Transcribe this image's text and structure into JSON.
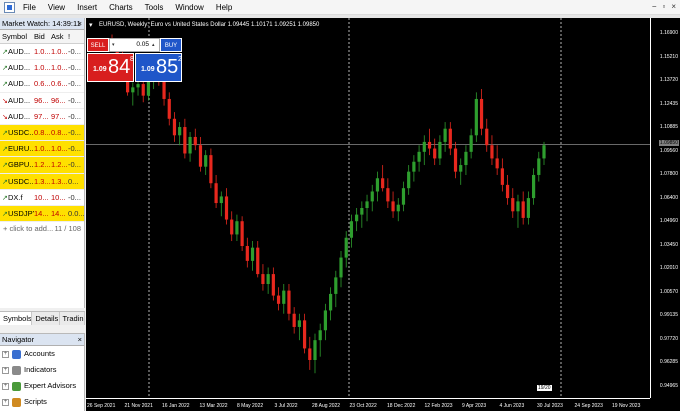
{
  "menu": {
    "items": [
      "File",
      "View",
      "Insert",
      "Charts",
      "Tools",
      "Window",
      "Help"
    ],
    "window_controls": [
      "−",
      "▫",
      "×"
    ]
  },
  "market_watch": {
    "title": "Market Watch: 14:39:11",
    "columns": [
      "Symbol",
      "Bid",
      "Ask",
      "!"
    ],
    "rows": [
      {
        "symbol": "AUD...",
        "bid": "1.0...",
        "ask": "1.0...",
        "spread": "-0...",
        "dir": "up",
        "highlight": false
      },
      {
        "symbol": "AUD...",
        "bid": "1.0...",
        "ask": "1.0...",
        "spread": "-0...",
        "dir": "up",
        "highlight": false
      },
      {
        "symbol": "AUD...",
        "bid": "0.6...",
        "ask": "0.6...",
        "spread": "-0...",
        "dir": "up",
        "highlight": false
      },
      {
        "symbol": "AUD...",
        "bid": "96...",
        "ask": "96...",
        "spread": "-0...",
        "dir": "down",
        "highlight": false
      },
      {
        "symbol": "AUD...",
        "bid": "97...",
        "ask": "97...",
        "spread": "-0...",
        "dir": "down",
        "highlight": false
      },
      {
        "symbol": "USDC...",
        "bid": "0.8...",
        "ask": "0.8...",
        "spread": "-0...",
        "dir": "up",
        "highlight": true
      },
      {
        "symbol": "EURU...",
        "bid": "1.0...",
        "ask": "1.0...",
        "spread": "-0...",
        "dir": "up",
        "highlight": true
      },
      {
        "symbol": "GBPU...",
        "bid": "1.2...",
        "ask": "1.2...",
        "spread": "-0...",
        "dir": "up",
        "highlight": true
      },
      {
        "symbol": "USDC...",
        "bid": "1.3...",
        "ask": "1.3...",
        "spread": "0...",
        "dir": "up",
        "highlight": true
      },
      {
        "symbol": "DX.f",
        "bid": "10...",
        "ask": "10...",
        "spread": "-0...",
        "dir": "up",
        "highlight": false
      },
      {
        "symbol": "USDJPY",
        "bid": "14...",
        "ask": "14...",
        "spread": "0.0...",
        "dir": "up",
        "highlight": true
      }
    ],
    "add_label": "+ click to add...",
    "count": "11 / 108",
    "tabs": [
      "Symbols",
      "Details",
      "Tradin"
    ]
  },
  "navigator": {
    "title": "Navigator",
    "items": [
      {
        "label": "Accounts",
        "color": "#3a6fd0"
      },
      {
        "label": "Indicators",
        "color": "#8a8a8a"
      },
      {
        "label": "Expert Advisors",
        "color": "#4a9a3a"
      },
      {
        "label": "Scripts",
        "color": "#d08a20"
      }
    ]
  },
  "chart": {
    "title": "EURUSD, Weekly: Euro vs United States Dollar  1.09445  1.10171  1.09251  1.09850",
    "price_labels": [
      "1.16900",
      "1.15210",
      "1.13720",
      "1.12435",
      "1.10885",
      "1.09560",
      "1.07800",
      "1.06400",
      "1.04960",
      "1.03450",
      "1.02010",
      "1.00570",
      "0.99135",
      "0.97720",
      "0.96285",
      "0.94965"
    ],
    "current_price": "1.09850",
    "time_labels": [
      "26 Sep 2021",
      "21 Nov 2021",
      "16 Jan 2022",
      "13 Mar 2022",
      "8 May 2022",
      "3 Jul 2022",
      "28 Aug 2022",
      "23 Oct 2022",
      "18 Dec 2022",
      "12 Feb 2023",
      "9 Apr 2023",
      "4 Jun 2023",
      "30 Jul 2023",
      "24 Sep 2023",
      "19 Nov 2023"
    ],
    "cursor_badge": "19/20",
    "up_color": "#2e9e2e",
    "down_color": "#e8281e",
    "candles": [
      [
        1.16,
        1.165,
        1.155,
        1.158
      ],
      [
        1.158,
        1.162,
        1.15,
        1.153
      ],
      [
        1.153,
        1.158,
        1.145,
        1.15
      ],
      [
        1.15,
        1.152,
        1.128,
        1.13
      ],
      [
        1.13,
        1.136,
        1.122,
        1.133
      ],
      [
        1.133,
        1.14,
        1.128,
        1.135
      ],
      [
        1.135,
        1.138,
        1.124,
        1.128
      ],
      [
        1.128,
        1.14,
        1.125,
        1.137
      ],
      [
        1.137,
        1.146,
        1.132,
        1.142
      ],
      [
        1.142,
        1.148,
        1.134,
        1.138
      ],
      [
        1.138,
        1.144,
        1.122,
        1.126
      ],
      [
        1.126,
        1.13,
        1.11,
        1.114
      ],
      [
        1.114,
        1.118,
        1.1,
        1.104
      ],
      [
        1.104,
        1.112,
        1.098,
        1.109
      ],
      [
        1.109,
        1.114,
        1.09,
        1.093
      ],
      [
        1.093,
        1.106,
        1.088,
        1.103
      ],
      [
        1.103,
        1.108,
        1.095,
        1.098
      ],
      [
        1.098,
        1.103,
        1.082,
        1.085
      ],
      [
        1.085,
        1.095,
        1.08,
        1.092
      ],
      [
        1.092,
        1.096,
        1.072,
        1.075
      ],
      [
        1.075,
        1.08,
        1.06,
        1.063
      ],
      [
        1.063,
        1.07,
        1.055,
        1.067
      ],
      [
        1.067,
        1.072,
        1.05,
        1.053
      ],
      [
        1.053,
        1.058,
        1.04,
        1.044
      ],
      [
        1.044,
        1.056,
        1.04,
        1.052
      ],
      [
        1.052,
        1.055,
        1.034,
        1.037
      ],
      [
        1.037,
        1.042,
        1.024,
        1.028
      ],
      [
        1.028,
        1.04,
        1.022,
        1.036
      ],
      [
        1.036,
        1.04,
        1.018,
        1.02
      ],
      [
        1.02,
        1.026,
        1.01,
        1.014
      ],
      [
        1.014,
        1.024,
        1.008,
        1.02
      ],
      [
        1.02,
        1.024,
        1.004,
        1.007
      ],
      [
        1.007,
        1.012,
        0.998,
        1.002
      ],
      [
        1.002,
        1.014,
        0.996,
        1.01
      ],
      [
        1.01,
        1.014,
        0.992,
        0.996
      ],
      [
        0.996,
        1.0,
        0.984,
        0.988
      ],
      [
        0.988,
        0.996,
        0.98,
        0.992
      ],
      [
        0.992,
        0.996,
        0.972,
        0.975
      ],
      [
        0.975,
        0.982,
        0.962,
        0.968
      ],
      [
        0.968,
        0.984,
        0.96,
        0.98
      ],
      [
        0.98,
        0.99,
        0.97,
        0.986
      ],
      [
        0.986,
        1.002,
        0.98,
        0.998
      ],
      [
        0.998,
        1.012,
        0.992,
        1.008
      ],
      [
        1.008,
        1.022,
        1.0,
        1.018
      ],
      [
        1.018,
        1.034,
        1.012,
        1.03
      ],
      [
        1.03,
        1.046,
        1.024,
        1.042
      ],
      [
        1.042,
        1.056,
        1.036,
        1.052
      ],
      [
        1.052,
        1.06,
        1.046,
        1.056
      ],
      [
        1.056,
        1.064,
        1.048,
        1.06
      ],
      [
        1.06,
        1.068,
        1.052,
        1.064
      ],
      [
        1.064,
        1.074,
        1.058,
        1.07
      ],
      [
        1.07,
        1.082,
        1.064,
        1.078
      ],
      [
        1.078,
        1.086,
        1.07,
        1.072
      ],
      [
        1.072,
        1.078,
        1.06,
        1.064
      ],
      [
        1.064,
        1.07,
        1.054,
        1.058
      ],
      [
        1.058,
        1.066,
        1.052,
        1.062
      ],
      [
        1.062,
        1.076,
        1.058,
        1.072
      ],
      [
        1.072,
        1.086,
        1.068,
        1.082
      ],
      [
        1.082,
        1.092,
        1.076,
        1.088
      ],
      [
        1.088,
        1.098,
        1.082,
        1.094
      ],
      [
        1.094,
        1.104,
        1.086,
        1.1
      ],
      [
        1.1,
        1.108,
        1.092,
        1.096
      ],
      [
        1.096,
        1.102,
        1.086,
        1.09
      ],
      [
        1.09,
        1.104,
        1.086,
        1.1
      ],
      [
        1.1,
        1.112,
        1.094,
        1.108
      ],
      [
        1.108,
        1.112,
        1.092,
        1.096
      ],
      [
        1.096,
        1.1,
        1.078,
        1.082
      ],
      [
        1.082,
        1.09,
        1.074,
        1.086
      ],
      [
        1.086,
        1.098,
        1.08,
        1.094
      ],
      [
        1.094,
        1.108,
        1.09,
        1.104
      ],
      [
        1.104,
        1.13,
        1.1,
        1.126
      ],
      [
        1.126,
        1.132,
        1.104,
        1.108
      ],
      [
        1.108,
        1.114,
        1.094,
        1.098
      ],
      [
        1.098,
        1.104,
        1.086,
        1.09
      ],
      [
        1.09,
        1.098,
        1.08,
        1.084
      ],
      [
        1.084,
        1.09,
        1.07,
        1.074
      ],
      [
        1.074,
        1.08,
        1.062,
        1.066
      ],
      [
        1.066,
        1.072,
        1.054,
        1.058
      ],
      [
        1.058,
        1.068,
        1.048,
        1.064
      ],
      [
        1.064,
        1.07,
        1.05,
        1.054
      ],
      [
        1.054,
        1.07,
        1.05,
        1.066
      ],
      [
        1.066,
        1.084,
        1.062,
        1.08
      ],
      [
        1.08,
        1.094,
        1.076,
        1.09
      ],
      [
        1.09,
        1.1,
        1.086,
        1.098
      ]
    ]
  }
}
